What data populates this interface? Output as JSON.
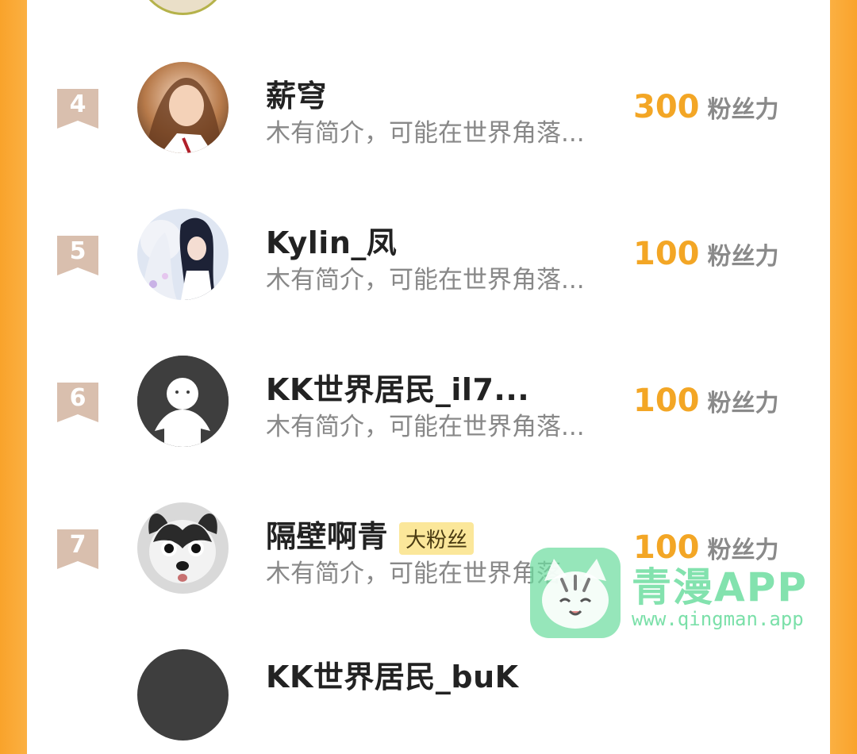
{
  "fans_label": "粉丝力",
  "rows": [
    {
      "rank": "4",
      "name": "薪穹",
      "desc": "木有简介，可能在世界角落...",
      "score": "300"
    },
    {
      "rank": "5",
      "name": "Kylin_凤",
      "desc": "木有简介，可能在世界角落...",
      "score": "100"
    },
    {
      "rank": "6",
      "name": "KK世界居民_il7...",
      "desc": "木有简介，可能在世界角落...",
      "score": "100"
    },
    {
      "rank": "7",
      "name": "隔壁啊青",
      "badge": "大粉丝",
      "desc": "木有简介，可能在世界角落...",
      "score": "100"
    },
    {
      "rank": "",
      "name": "KK世界居民_buK",
      "desc": "",
      "score": ""
    }
  ],
  "watermark": {
    "title": "青漫APP",
    "url": "www.qingman.app"
  },
  "colors": {
    "side_orange": "#f9a32b",
    "score": "#f3a625",
    "rank_bg": "#d9bfae",
    "badge_bg": "#fbe79a",
    "watermark": "#6ddda0"
  }
}
